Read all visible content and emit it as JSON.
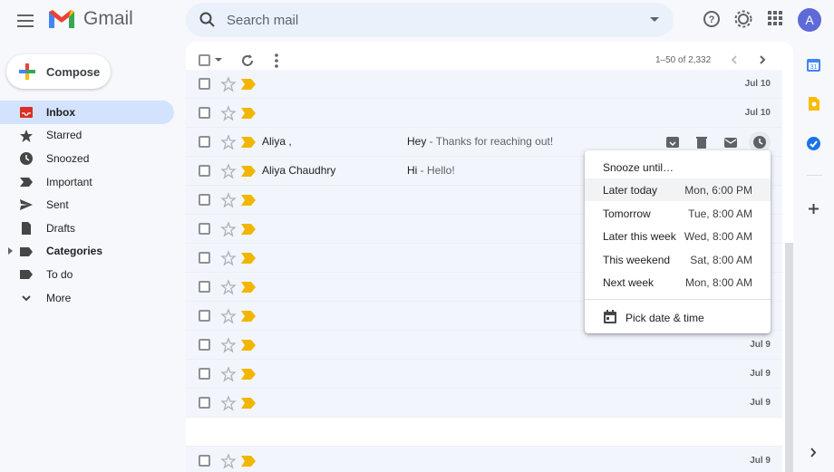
{
  "app": {
    "logo_text": "Gmail",
    "avatar_letter": "A",
    "search_placeholder": "Search mail"
  },
  "sidebar": {
    "compose_label": "Compose",
    "items": [
      {
        "label": "Inbox",
        "icon": "inbox-icon",
        "active": true
      },
      {
        "label": "Starred",
        "icon": "star-icon"
      },
      {
        "label": "Snoozed",
        "icon": "clock-icon"
      },
      {
        "label": "Important",
        "icon": "label-important-icon"
      },
      {
        "label": "Sent",
        "icon": "send-icon"
      },
      {
        "label": "Drafts",
        "icon": "draft-icon"
      },
      {
        "label": "Categories",
        "icon": "label-icon",
        "bold": true
      },
      {
        "label": "To do",
        "icon": "label-icon"
      },
      {
        "label": "More",
        "icon": "chevron-down-icon"
      }
    ]
  },
  "toolbar": {
    "pager": "1–50 of 2,332"
  },
  "emails": [
    {
      "sender": "",
      "subject": "",
      "snippet": "",
      "date": "Jul 10"
    },
    {
      "sender": "",
      "subject": "",
      "snippet": "",
      "date": "Jul 10"
    },
    {
      "sender": "Aliya ,",
      "subject": "Hey",
      "snippet": " - Thanks for reaching out!",
      "date": ""
    },
    {
      "sender": "Aliya Chaudhry",
      "subject": "Hi",
      "snippet": " - Hello!",
      "date": ""
    },
    {
      "sender": "",
      "subject": "",
      "snippet": "",
      "date": ""
    },
    {
      "sender": "",
      "subject": "",
      "snippet": "",
      "date": ""
    },
    {
      "sender": "",
      "subject": "",
      "snippet": "",
      "date": ""
    },
    {
      "sender": "",
      "subject": "",
      "snippet": "",
      "date": ""
    },
    {
      "sender": "",
      "subject": "",
      "snippet": "",
      "date": ""
    },
    {
      "sender": "",
      "subject": "",
      "snippet": "",
      "date": "Jul 9"
    },
    {
      "sender": "",
      "subject": "",
      "snippet": "",
      "date": "Jul 9"
    },
    {
      "sender": "",
      "subject": "",
      "snippet": "",
      "date": "Jul 9"
    },
    {
      "sender": "",
      "subject": "",
      "snippet": "",
      "date": "",
      "gap": true
    },
    {
      "sender": "",
      "subject": "",
      "snippet": "",
      "date": "Jul 9"
    }
  ],
  "snooze_menu": {
    "header": "Snooze until…",
    "options": [
      {
        "label": "Later today",
        "value": "Mon, 6:00 PM",
        "highlighted": true
      },
      {
        "label": "Tomorrow",
        "value": "Tue, 8:00 AM"
      },
      {
        "label": "Later this week",
        "value": "Wed, 8:00 AM"
      },
      {
        "label": "This weekend",
        "value": "Sat, 8:00 AM"
      },
      {
        "label": "Next week",
        "value": "Mon, 8:00 AM"
      }
    ],
    "pick_label": "Pick date & time"
  },
  "colors": {
    "accent": "#0b57d0",
    "important_marker": "#f2b600",
    "active_nav": "#d3e3fd",
    "avatar_bg": "#5f6ad8"
  }
}
